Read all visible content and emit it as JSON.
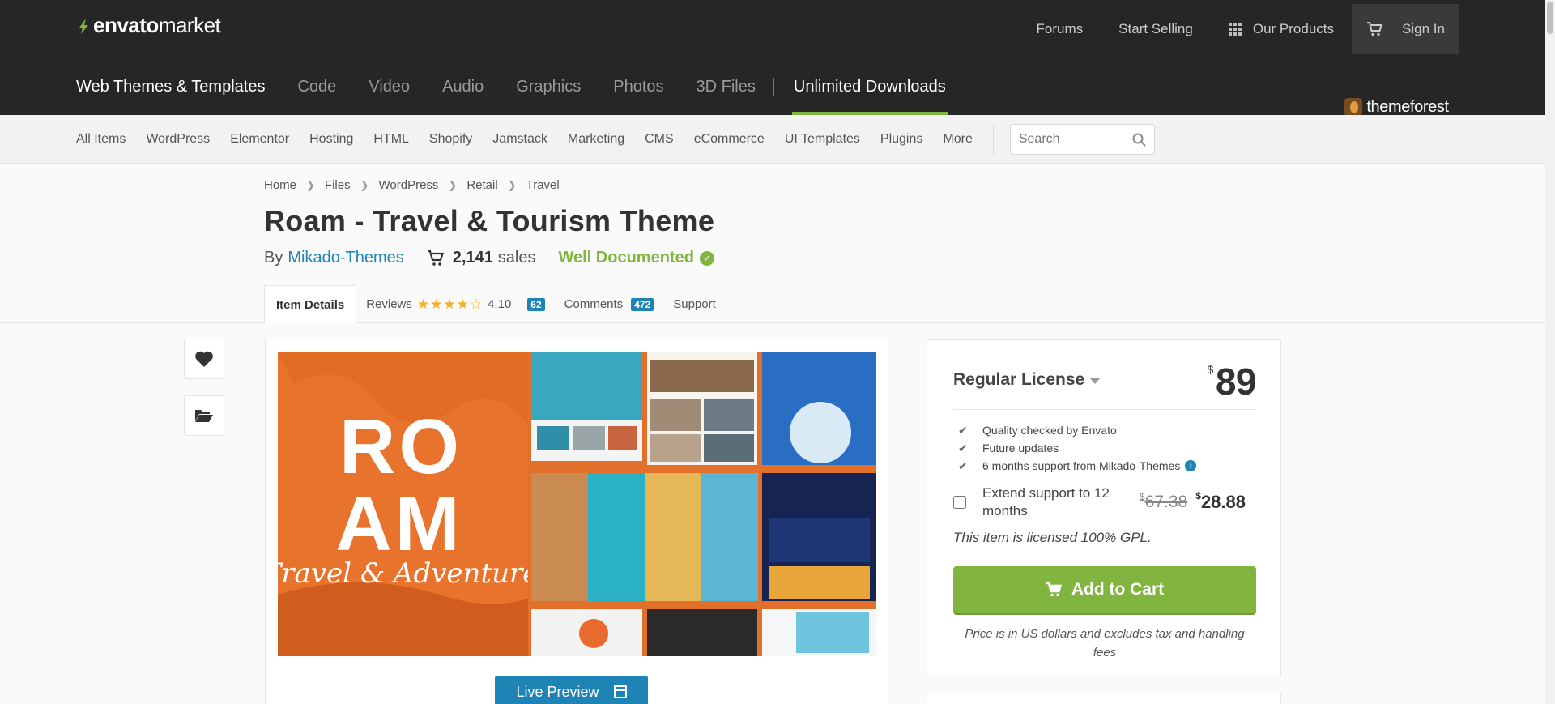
{
  "brand": {
    "logo_prefix": "envato",
    "logo_suffix": "market",
    "marketplace": "themeforest"
  },
  "top_links": {
    "forums": "Forums",
    "start_selling": "Start Selling",
    "our_products": "Our Products",
    "sign_in": "Sign In"
  },
  "categories": [
    "Web Themes & Templates",
    "Code",
    "Video",
    "Audio",
    "Graphics",
    "Photos",
    "3D Files",
    "Unlimited Downloads"
  ],
  "subnav": {
    "items": [
      "All Items",
      "WordPress",
      "Elementor",
      "Hosting",
      "HTML",
      "Shopify",
      "Jamstack",
      "Marketing",
      "CMS",
      "eCommerce",
      "UI Templates",
      "Plugins",
      "More"
    ],
    "search_placeholder": "Search"
  },
  "breadcrumb": [
    "Home",
    "Files",
    "WordPress",
    "Retail",
    "Travel"
  ],
  "item": {
    "title": "Roam - Travel & Tourism Theme",
    "by_label": "By",
    "author": "Mikado-Themes",
    "sales_count": "2,141",
    "sales_label": "sales",
    "well_documented": "Well Documented"
  },
  "tabs": {
    "item_details": "Item Details",
    "reviews": "Reviews",
    "rating": "4.10",
    "rating_value": 4.1,
    "reviews_count": "62",
    "comments": "Comments",
    "comments_count": "472",
    "support": "Support"
  },
  "preview": {
    "live_preview_label": "Live Preview",
    "cover_line1": "RO",
    "cover_line2": "AM",
    "cover_script": "Travel & Adventure"
  },
  "license": {
    "name": "Regular License",
    "currency_symbol": "$",
    "price": "89",
    "features": [
      "Quality checked by Envato",
      "Future updates",
      "6 months support from Mikado-Themes"
    ],
    "extend_label": "Extend support to 12 months",
    "extend_old_price": "67.38",
    "extend_new_price": "28.88",
    "gpl_note": "This item is licensed 100% GPL.",
    "add_to_cart": "Add to Cart",
    "price_note": "Price is in US dollars and excludes tax and handling fees"
  },
  "colors": {
    "accent_green": "#82b440",
    "link_blue": "#1d84b5",
    "header_dark": "#262626",
    "star_gold": "#f4b02a"
  }
}
